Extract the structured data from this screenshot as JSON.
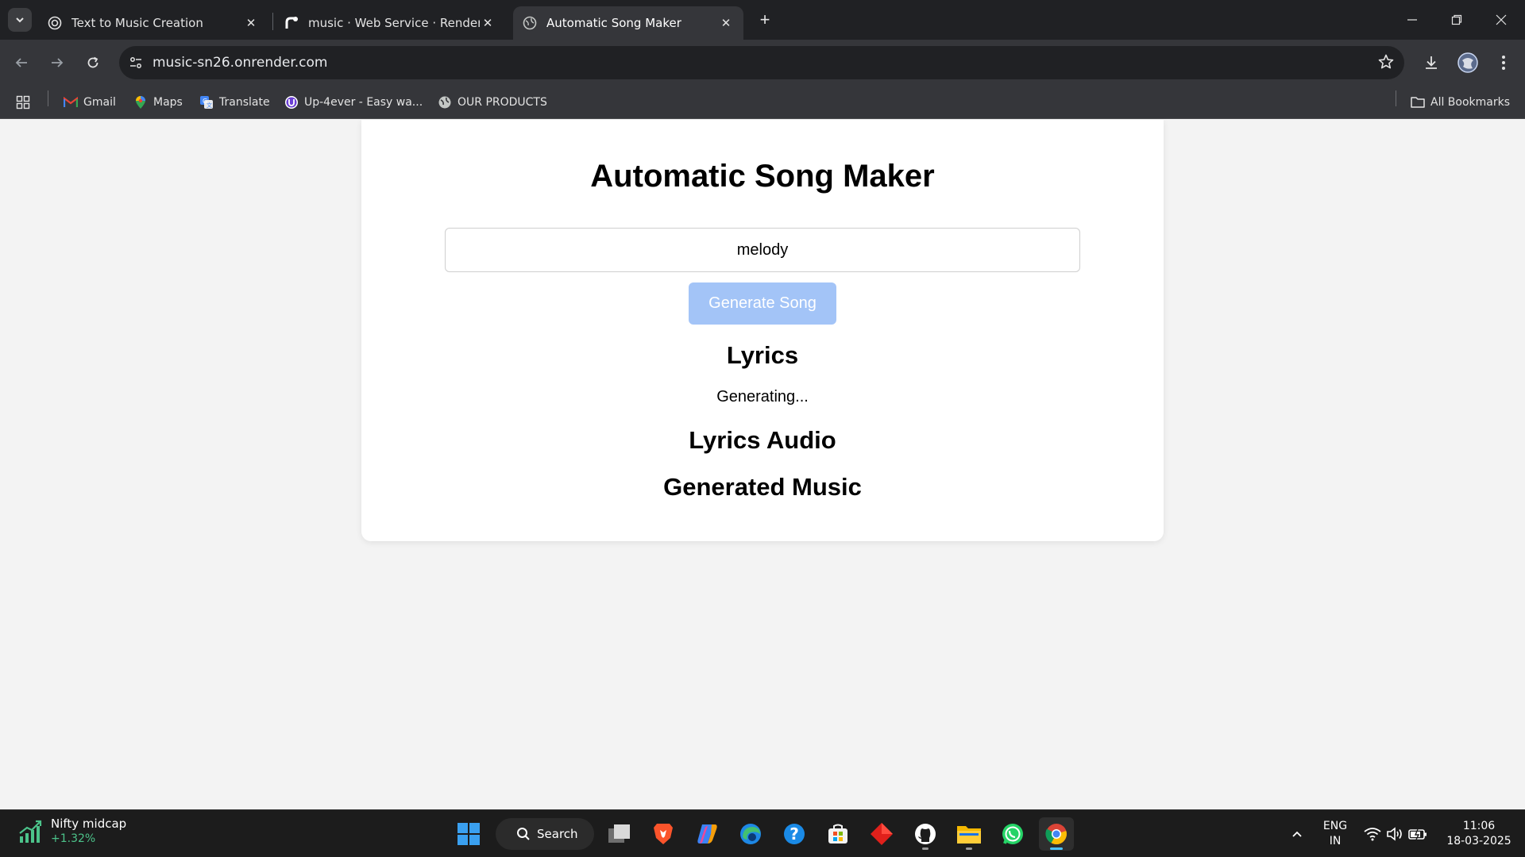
{
  "browser": {
    "tabs": [
      {
        "title": "Text to Music Creation",
        "icon": "openai-icon",
        "active": false
      },
      {
        "title": "music · Web Service · Render D",
        "icon": "render-icon",
        "active": false
      },
      {
        "title": "Automatic Song Maker",
        "icon": "globe-icon",
        "active": true
      }
    ],
    "url": "music-sn26.onrender.com",
    "bookmarks": [
      {
        "label": "Gmail",
        "icon": "gmail-icon"
      },
      {
        "label": "Maps",
        "icon": "maps-icon"
      },
      {
        "label": "Translate",
        "icon": "translate-icon"
      },
      {
        "label": "Up-4ever - Easy wa...",
        "icon": "up4ever-icon"
      },
      {
        "label": "OUR PRODUCTS",
        "icon": "globe-icon"
      }
    ],
    "all_bookmarks": "All Bookmarks"
  },
  "page": {
    "title": "Automatic Song Maker",
    "prompt_value": "melody",
    "generate_button": "Generate Song",
    "lyrics_heading": "Lyrics",
    "lyrics_status": "Generating...",
    "lyrics_audio_heading": "Lyrics Audio",
    "generated_music_heading": "Generated Music"
  },
  "taskbar": {
    "widget_name": "Nifty midcap",
    "widget_value": "+1.32%",
    "search_label": "Search",
    "language": "ENG",
    "region": "IN",
    "time": "11:06",
    "date": "18-03-2025",
    "apps": [
      "start",
      "search",
      "task-view",
      "brave",
      "copilot",
      "edge",
      "help",
      "store",
      "git",
      "github",
      "file-explorer",
      "whatsapp",
      "chrome"
    ]
  },
  "colors": {
    "button_disabled": "#a3c4f7",
    "tab_bar": "#202124",
    "toolbar": "#35363a",
    "page_bg": "#f3f3f3",
    "taskbar": "#1c1c1c"
  }
}
